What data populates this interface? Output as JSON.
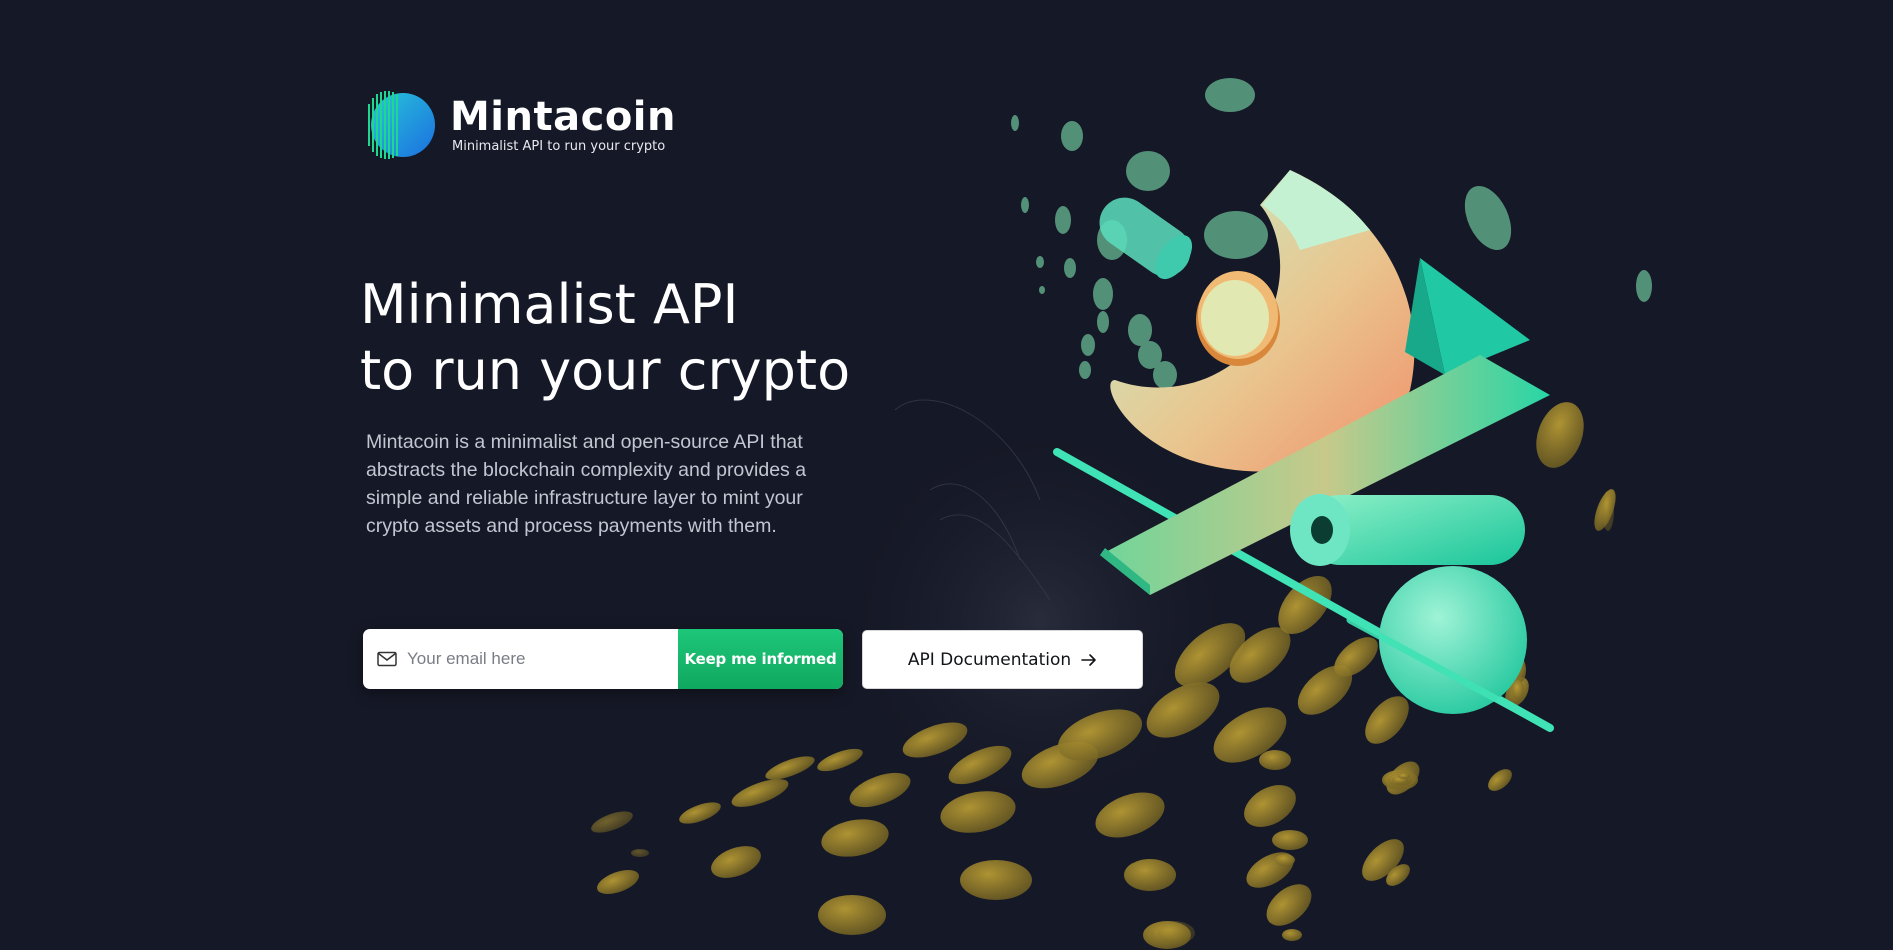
{
  "brand": {
    "name": "Mintacoin",
    "tagline": "Minimalist API to run your crypto"
  },
  "hero": {
    "title_line1": "Minimalist API",
    "title_line2": "to run your crypto",
    "description": "Mintacoin is a minimalist and open-source API that abstracts the blockchain complexity and provides a simple and reliable infrastructure layer to mint your crypto assets and process payments with them."
  },
  "form": {
    "email_placeholder": "Your email here",
    "email_value": "",
    "submit_label": "Keep me informed"
  },
  "docs": {
    "label": "API Documentation"
  },
  "icons": {
    "mail": "mail-icon",
    "arrow": "arrow-right-icon",
    "logo": "mintacoin-logo-icon"
  },
  "colors": {
    "background": "#151826",
    "accent_green": "#16b86b",
    "mint": "#3fe3b5",
    "gold": "#a88d2a"
  }
}
